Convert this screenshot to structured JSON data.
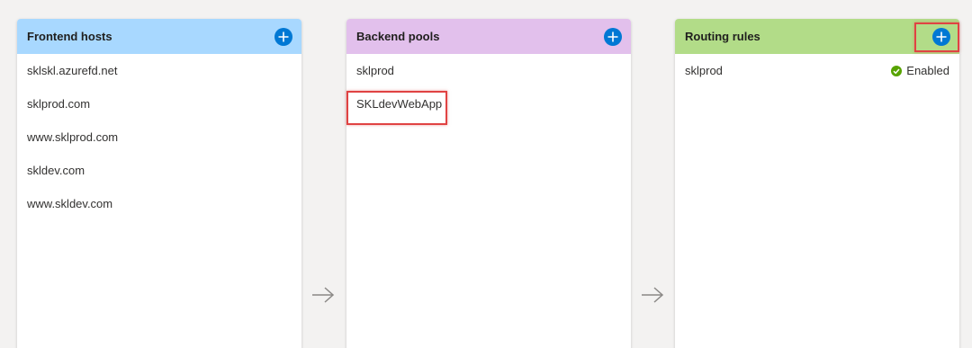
{
  "colors": {
    "frontend_header": "#a8d8ff",
    "backend_header": "#e2c0ec",
    "routing_header": "#b2dc88",
    "add_button": "#0078d4",
    "highlight": "#e04343",
    "enabled_icon": "#57a300"
  },
  "frontend": {
    "title": "Frontend hosts",
    "add_icon": "plus-circle-icon",
    "items": [
      {
        "label": "sklskl.azurefd.net"
      },
      {
        "label": "sklprod.com"
      },
      {
        "label": "www.sklprod.com"
      },
      {
        "label": "skldev.com"
      },
      {
        "label": "www.skldev.com"
      }
    ]
  },
  "backend": {
    "title": "Backend pools",
    "add_icon": "plus-circle-icon",
    "items": [
      {
        "label": "sklprod"
      },
      {
        "label": "SKLdevWebApp"
      }
    ]
  },
  "routing": {
    "title": "Routing rules",
    "add_icon": "plus-circle-icon",
    "items": [
      {
        "label": "sklprod",
        "status": "Enabled",
        "status_icon": "check-circle-icon"
      }
    ]
  },
  "connectors": {
    "icon": "right-arrow-icon"
  }
}
